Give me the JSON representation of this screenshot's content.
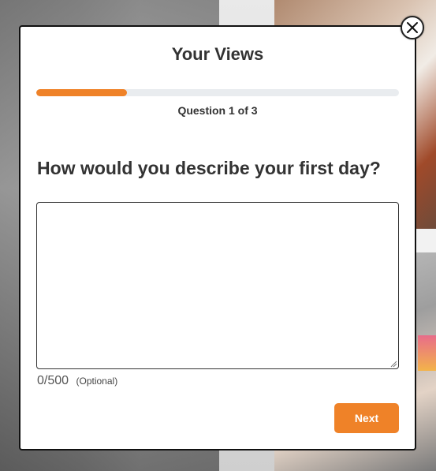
{
  "modal": {
    "title": "Your Views",
    "progress": {
      "label": "Question 1 of 3",
      "current": 1,
      "total": 3,
      "fraction": 0.25,
      "color": "#ef8228"
    },
    "question": "How would you describe your first day?",
    "answer": {
      "value": "",
      "placeholder": ""
    },
    "char_counter": "0/500",
    "optional_label": "(Optional)",
    "next_button_label": "Next",
    "close_icon": "close-icon"
  },
  "colors": {
    "accent": "#ef8228",
    "text": "#333333",
    "track": "#e9ecef"
  }
}
